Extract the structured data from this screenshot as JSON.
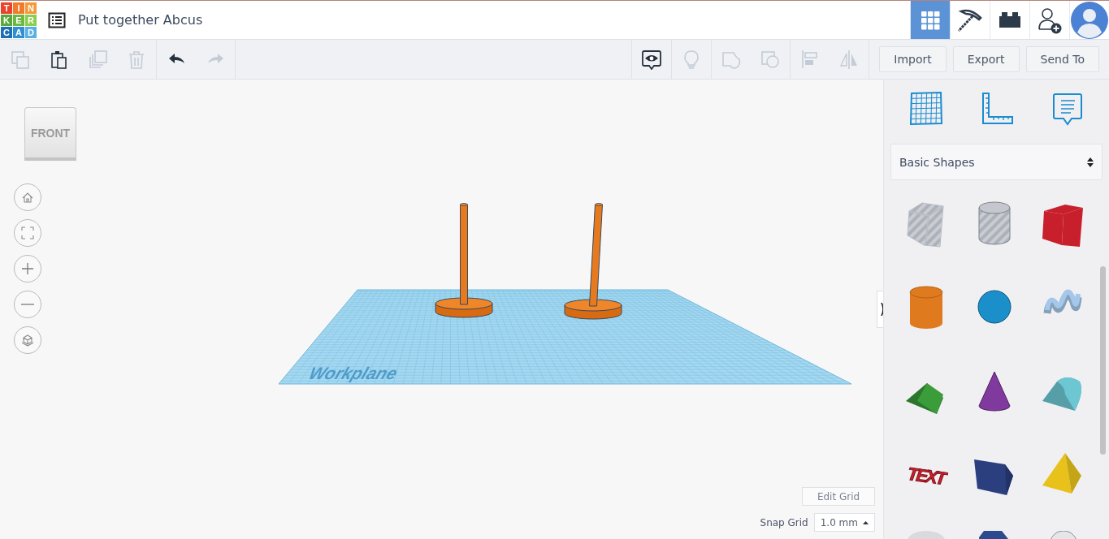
{
  "logo": {
    "tiles": [
      {
        "letter": "T",
        "color": "#e8432c"
      },
      {
        "letter": "I",
        "color": "#f07b2b"
      },
      {
        "letter": "N",
        "color": "#f29a3c"
      },
      {
        "letter": "K",
        "color": "#59a83b"
      },
      {
        "letter": "E",
        "color": "#6cb840"
      },
      {
        "letter": "R",
        "color": "#8ccd4e"
      },
      {
        "letter": "C",
        "color": "#1d6fb5"
      },
      {
        "letter": "A",
        "color": "#2f8fd0"
      },
      {
        "letter": "D",
        "color": "#5ab0e2"
      }
    ]
  },
  "title": "Put together Abcus",
  "header_tools": [
    {
      "kind": "grid",
      "selected": true
    },
    {
      "kind": "pickaxe",
      "selected": false
    },
    {
      "kind": "brick",
      "selected": false
    },
    {
      "kind": "add-user",
      "selected": false
    },
    {
      "kind": "avatar",
      "selected": false
    }
  ],
  "toolbar_left": [
    [
      {
        "kind": "copy",
        "disabled": true
      },
      {
        "kind": "paste",
        "disabled": false
      },
      {
        "kind": "duplicate",
        "disabled": true
      },
      {
        "kind": "delete",
        "disabled": true
      }
    ],
    [
      {
        "kind": "undo",
        "disabled": false
      },
      {
        "kind": "redo",
        "disabled": true
      }
    ]
  ],
  "toolbar_right": [
    [
      {
        "kind": "notes",
        "disabled": false
      }
    ],
    [
      {
        "kind": "bulb",
        "disabled": true
      }
    ],
    [
      {
        "kind": "group",
        "disabled": true
      },
      {
        "kind": "ungroup",
        "disabled": true
      }
    ],
    [
      {
        "kind": "align",
        "disabled": true
      },
      {
        "kind": "mirror",
        "disabled": true
      }
    ]
  ],
  "actions": [
    "Import",
    "Export",
    "Send To"
  ],
  "view_cube": "FRONT",
  "view_controls": [
    {
      "kind": "home"
    },
    {
      "kind": "fit"
    },
    {
      "kind": "zoom-in"
    },
    {
      "kind": "zoom-out"
    },
    {
      "kind": "perspective"
    }
  ],
  "workplane_label": "Workplane",
  "edit_grid": "Edit Grid",
  "snap_grid": {
    "label": "Snap Grid",
    "value": "1.0 mm"
  },
  "panel": {
    "tools": [
      {
        "kind": "workplane"
      },
      {
        "kind": "ruler"
      },
      {
        "kind": "notes"
      }
    ],
    "category": "Basic Shapes",
    "shapes": [
      {
        "kind": "box-hole",
        "color": "#b9bec6"
      },
      {
        "kind": "cylinder-hole",
        "color": "#c4c8ce"
      },
      {
        "kind": "box",
        "color": "#c71f2b"
      },
      {
        "kind": "cylinder",
        "color": "#e07a1f"
      },
      {
        "kind": "sphere",
        "color": "#1a8fc9"
      },
      {
        "kind": "scribble",
        "color": "#a5c8ea"
      },
      {
        "kind": "roof",
        "color": "#3b9c3a"
      },
      {
        "kind": "cone",
        "color": "#80399d"
      },
      {
        "kind": "round-roof",
        "color": "#6cc7d3"
      },
      {
        "kind": "text",
        "color": "#cc1f2c",
        "text": "TEXT"
      },
      {
        "kind": "polygon",
        "color": "#2b3f7f"
      },
      {
        "kind": "pyramid",
        "color": "#e8c21a"
      },
      {
        "kind": "paraboloid",
        "color": "#d8dade"
      },
      {
        "kind": "hexagon",
        "color": "#2d4a8f"
      },
      {
        "kind": "half-sphere",
        "color": "#e4e6e8"
      }
    ]
  }
}
